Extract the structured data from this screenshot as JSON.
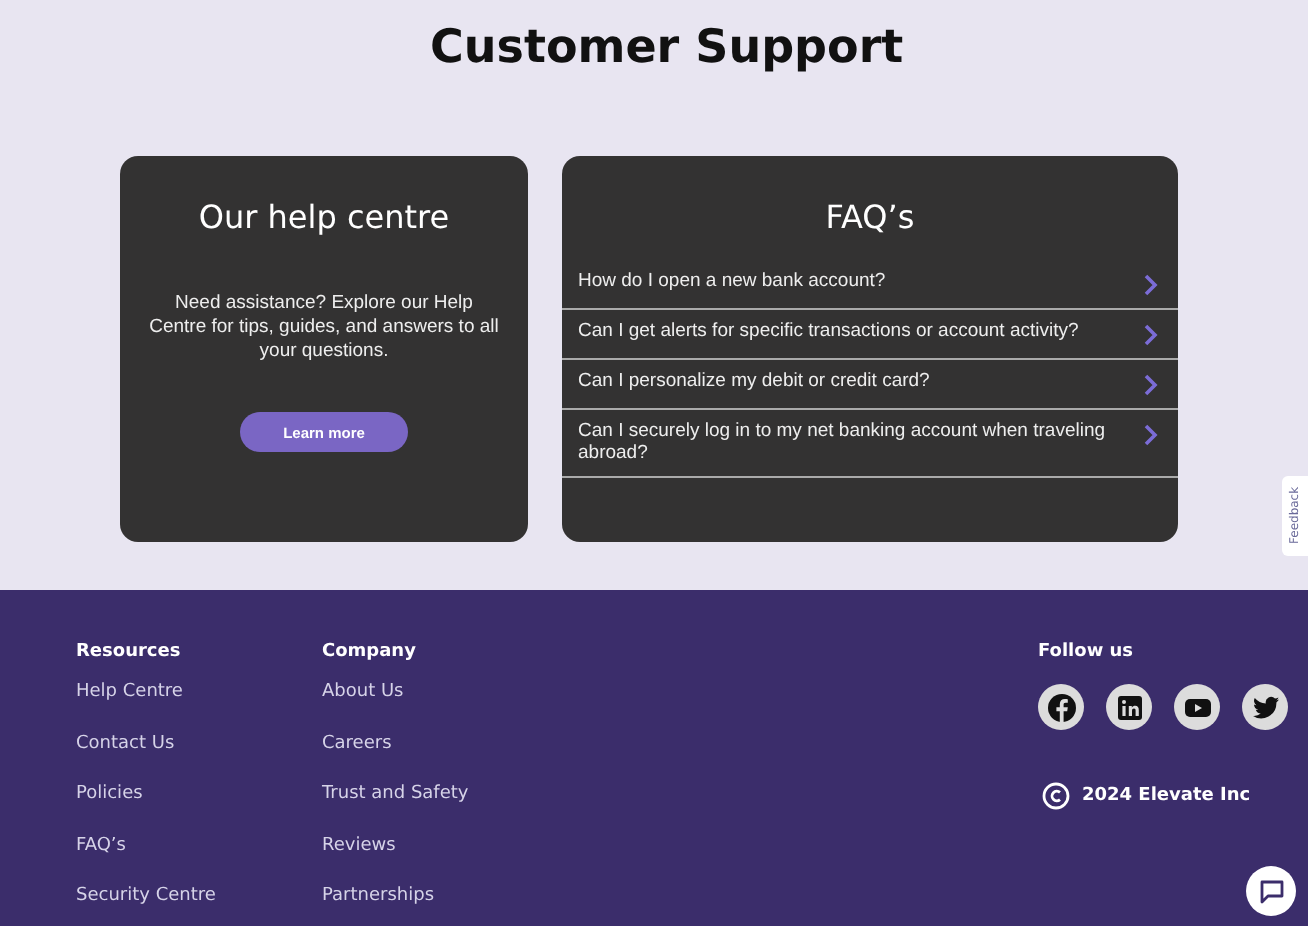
{
  "page_title": "Customer Support",
  "help_card": {
    "title": "Our help centre",
    "text": "Need assistance? Explore our Help Centre for tips, guides, and answers to all your questions.",
    "button": "Learn more"
  },
  "faq_card": {
    "title": "FAQ’s",
    "questions": [
      {
        "text": "How do I open a new bank account?"
      },
      {
        "text": "Can I get alerts for specific transactions or account activity?"
      },
      {
        "text": "Can I personalize my debit or credit card?"
      },
      {
        "text": "Can I securely log in to my net banking account when traveling abroad?"
      }
    ]
  },
  "feedback_tab": "Feedback",
  "footer": {
    "columns": [
      {
        "heading": "Resources",
        "links": [
          "Help Centre",
          "Contact Us",
          "Policies",
          "FAQ’s",
          "Security Centre"
        ]
      },
      {
        "heading": "Company",
        "links": [
          "About Us",
          "Careers",
          "Trust and Safety",
          "Reviews",
          "Partnerships"
        ]
      }
    ],
    "follow": {
      "heading": "Follow us",
      "networks": [
        {
          "kind": "facebook"
        },
        {
          "kind": "linkedin"
        },
        {
          "kind": "youtube"
        },
        {
          "kind": "twitter"
        }
      ]
    },
    "copyright": "2024 Elevate Inc"
  }
}
